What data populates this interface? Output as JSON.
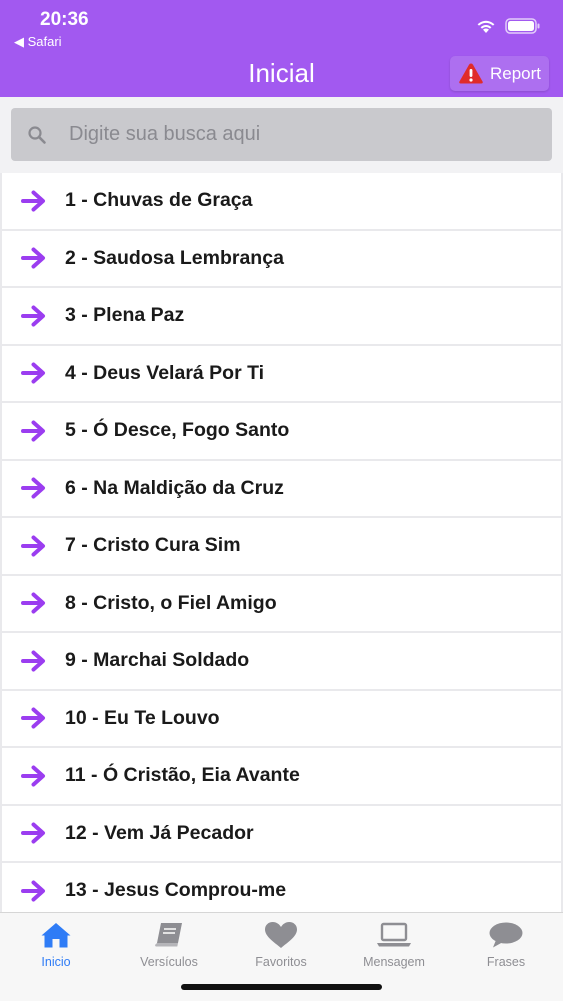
{
  "status_bar": {
    "time": "20:36",
    "back_label": "◀ Safari"
  },
  "header": {
    "title": "Inicial",
    "report_label": "Report"
  },
  "search": {
    "placeholder": "Digite sua busca aqui",
    "value": ""
  },
  "list": {
    "items": [
      {
        "label": "1 - Chuvas de Graça"
      },
      {
        "label": "2 - Saudosa Lembrança"
      },
      {
        "label": "3 - Plena Paz"
      },
      {
        "label": "4 - Deus Velará Por Ti"
      },
      {
        "label": "5 - Ó Desce, Fogo Santo"
      },
      {
        "label": "6 - Na Maldição da Cruz"
      },
      {
        "label": "7 - Cristo Cura Sim"
      },
      {
        "label": "8 - Cristo, o Fiel Amigo"
      },
      {
        "label": "9 - Marchai Soldado"
      },
      {
        "label": "10 - Eu Te Louvo"
      },
      {
        "label": "11 - Ó Cristão, Eia Avante"
      },
      {
        "label": "12 - Vem Já Pecador"
      },
      {
        "label": "13 - Jesus Comprou-me"
      }
    ]
  },
  "tabs": [
    {
      "label": "Inicio",
      "icon": "home-icon",
      "active": true
    },
    {
      "label": "Versículos",
      "icon": "book-icon",
      "active": false
    },
    {
      "label": "Favoritos",
      "icon": "heart-icon",
      "active": false
    },
    {
      "label": "Mensagem",
      "icon": "laptop-icon",
      "active": false
    },
    {
      "label": "Frases",
      "icon": "chat-bubble-icon",
      "active": false
    }
  ],
  "colors": {
    "header": "#a259f0",
    "accent_arrow": "#9b3df0",
    "active_tab": "#2f7cf6",
    "inactive_tab": "#8e8e93",
    "warning": "#e02b2b"
  }
}
